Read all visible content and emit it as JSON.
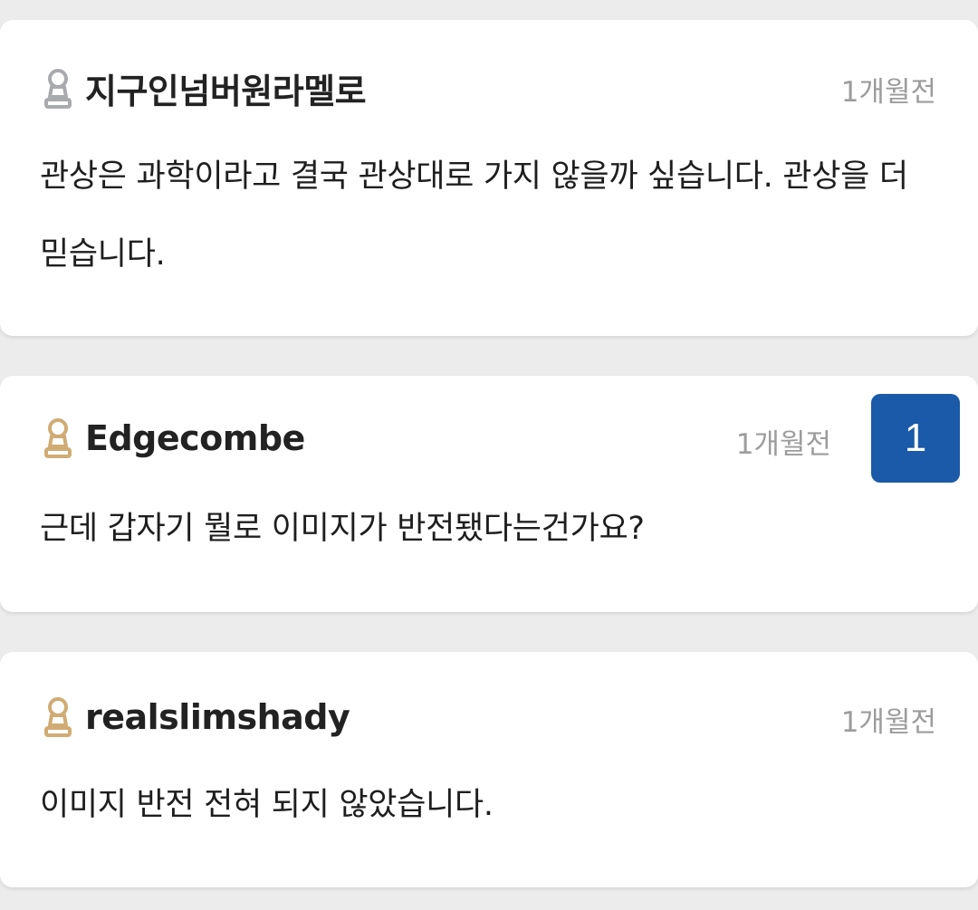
{
  "colors": {
    "page_background": "#ececec",
    "card_background": "#ffffff",
    "badge_background": "#1a5aa8",
    "rank_gray": "#a9aaad",
    "rank_gold": "#d0ab73"
  },
  "comments": [
    {
      "username": "지구인넘버원라멜로",
      "time": "1개월전",
      "text": "관상은 과학이라고 결국 관상대로 가지 않을까 싶습니다. 관상을 더 믿습니다.",
      "rank_icon": "pawn-rank-icon-gray"
    },
    {
      "username": "Edgecombe",
      "time": "1개월전",
      "text": "근데 갑자기 뭘로 이미지가 반전됐다는건가요?",
      "rank_icon": "pawn-rank-icon-gold",
      "reply_count": "1"
    },
    {
      "username": "realslimshady",
      "time": "1개월전",
      "text": "이미지 반전 전혀 되지 않았습니다.",
      "rank_icon": "pawn-rank-icon-gold"
    }
  ]
}
